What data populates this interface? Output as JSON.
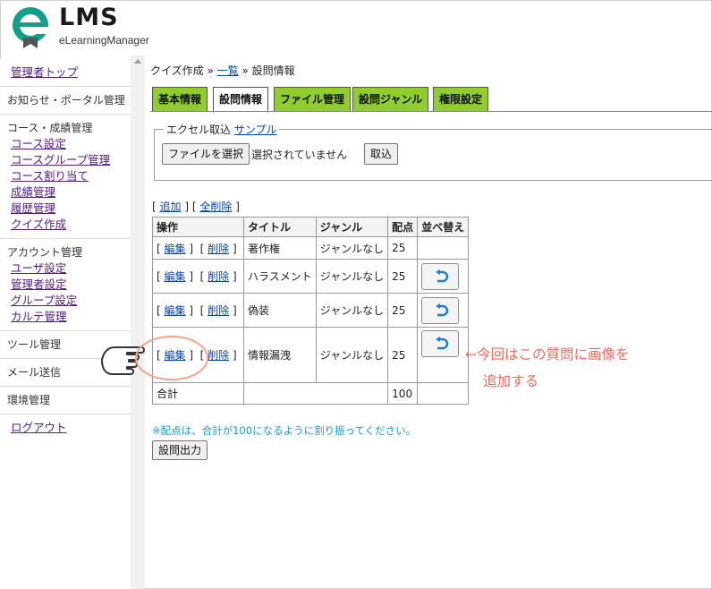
{
  "app": {
    "logo_title": "LMS",
    "logo_subtitle": "eLearningManager"
  },
  "sidebar": {
    "top_link": "管理者トップ",
    "groups": [
      {
        "heading": "お知らせ・ポータル管理",
        "items": []
      },
      {
        "heading": "コース・成績管理",
        "items": [
          "コース設定",
          "コースグループ管理",
          "コース割り当て",
          "成績管理",
          "履歴管理",
          "クイズ作成"
        ]
      },
      {
        "heading": "アカウント管理",
        "items": [
          "ユーザ設定",
          "管理者設定",
          "グループ設定",
          "カルテ管理"
        ]
      },
      {
        "heading": "ツール管理",
        "items": []
      },
      {
        "heading": "メール送信",
        "items": []
      },
      {
        "heading": "環境管理",
        "items": []
      }
    ],
    "logout": "ログアウト"
  },
  "breadcrumb": {
    "root": "クイズ作成",
    "sep1": "»",
    "link": "一覧",
    "sep2": "»",
    "current": "設問情報"
  },
  "tabs": [
    "基本情報",
    "設問情報",
    "ファイル管理",
    "設問ジャンル",
    "権限設定"
  ],
  "active_tab": "設問情報",
  "import": {
    "legend": "エクセル取込",
    "sample_link": "サンプル",
    "file_button": "ファイルを選択",
    "file_status": "選択されていません",
    "import_button": "取込"
  },
  "list_actions": {
    "open": "[",
    "add": "追加",
    "mid": "] [",
    "delete_all": "全削除",
    "close": "]"
  },
  "table": {
    "headers": [
      "操作",
      "タイトル",
      "ジャンル",
      "配点",
      "並べ替え"
    ],
    "edit_label": "編集",
    "delete_label": "削除",
    "rows": [
      {
        "title": "著作権",
        "genre": "ジャンルなし",
        "score": "25"
      },
      {
        "title": "ハラスメント",
        "genre": "ジャンルなし",
        "score": "25"
      },
      {
        "title": "偽装",
        "genre": "ジャンルなし",
        "score": "25"
      },
      {
        "title": "情報漏洩",
        "genre": "ジャンルなし",
        "score": "25"
      }
    ],
    "total_label": "合計",
    "total_score": "100"
  },
  "note": "※配点は、合計が100になるように割り振ってください。",
  "output_button": "設問出力",
  "annotation": {
    "line1": "←今回はこの質問に画像を",
    "line2": "追加する",
    "color": "#f26a5a"
  },
  "colors": {
    "tab_green": "#8fce2e",
    "logo_teal": "#12a08a",
    "link_blue": "#0645ad",
    "visited_purple": "#551a8b",
    "note_blue": "#1a9bd0"
  }
}
